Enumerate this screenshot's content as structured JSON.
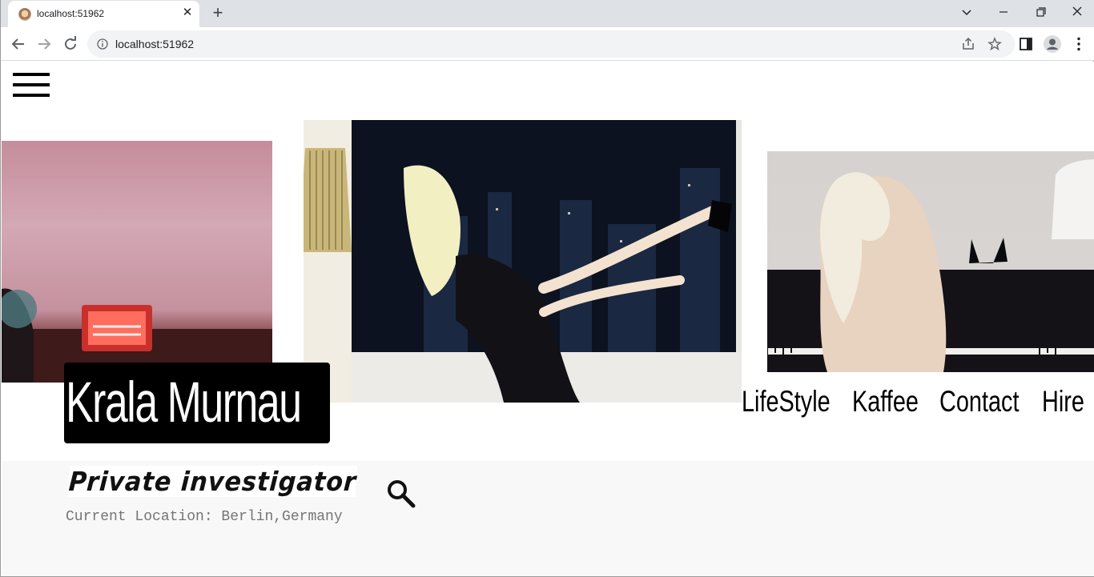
{
  "browser": {
    "tab_title": "localhost:51962",
    "url": "localhost:51962"
  },
  "site": {
    "name": "Krala Murnau",
    "nav": [
      {
        "label": "LifeStyle"
      },
      {
        "label": "Kaffee"
      },
      {
        "label": "Contact"
      },
      {
        "label": "Hire"
      }
    ],
    "subtitle": "Private investigator",
    "location": "Current Location: Berlin,Germany"
  },
  "images": [
    {
      "name": "pink-room-heater-photo"
    },
    {
      "name": "woman-black-dress-window-photo"
    },
    {
      "name": "woman-at-piano-photo"
    }
  ],
  "icons": {
    "menu": "hamburger-icon",
    "search": "search-icon"
  }
}
